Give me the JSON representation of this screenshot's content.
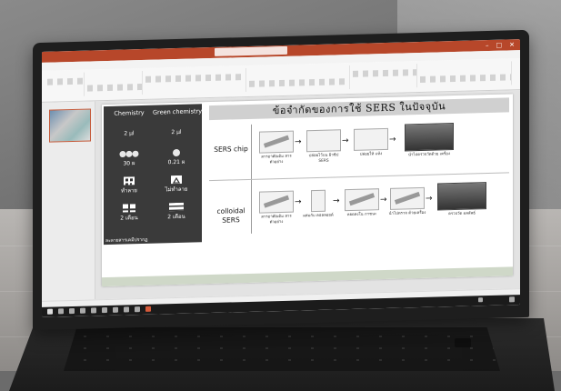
{
  "window": {
    "title": "",
    "search": "",
    "user": "",
    "ribbon_tabs": [
      "",
      "",
      "",
      "",
      "",
      "",
      "",
      ""
    ]
  },
  "slide": {
    "heading": "ข้อจำกัดของการใช้ SERS ในปัจจุบัน",
    "left_panel": {
      "columns": [
        "Chemistry",
        "Green chemistry"
      ],
      "rows": [
        [
          "2 µl",
          "2 µl"
        ],
        [
          "30 ผ",
          "0.21 ผ"
        ],
        [
          "ทำลาย",
          "ไม่ทำลาย"
        ],
        [
          "2 เดือน",
          "2 เดือน"
        ]
      ],
      "footnote": "ละลายสารเคมีปรากฏ"
    },
    "rows": [
      {
        "label": "SERS chip",
        "steps": [
          {
            "caption": "สารอาศัยเติม สารตัวอย่าง"
          },
          {
            "caption": "ปล่อยไว้บน ผิวชิป SERS"
          },
          {
            "caption": "ปล่อยให้ แห้ง"
          },
          {
            "caption": "นำไปตรวจวัดด้วย เครื่อง"
          }
        ]
      },
      {
        "label": "colloidal SERS",
        "steps": [
          {
            "caption": "สารอาศัยเติม สารตัวอย่าง"
          },
          {
            "caption": "ผสมกับ คอลลอยด์"
          },
          {
            "caption": "หยดลงใน ภาชนะ"
          },
          {
            "caption": "นำไปตรวจ ด้วยเครื่อง"
          },
          {
            "caption": "ตรวจวัด ผลลัพธ์"
          }
        ]
      }
    ]
  },
  "taskbar": {
    "time": "",
    "date": ""
  }
}
